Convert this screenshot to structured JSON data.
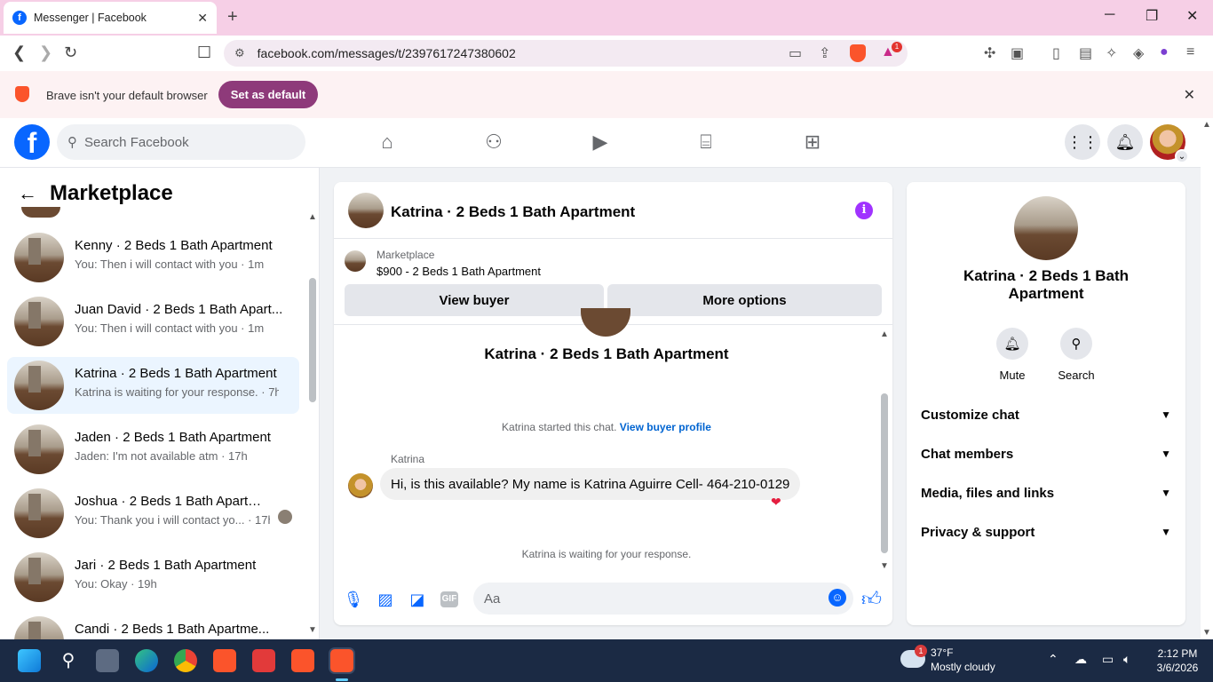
{
  "browser": {
    "tab_title": "Messenger | Facebook",
    "url": "facebook.com/messages/t/2397617247380602",
    "notification_count": "1",
    "banner_message": "Brave isn't your default browser",
    "banner_button": "Set as default"
  },
  "fb_header": {
    "search_placeholder": "Search Facebook"
  },
  "sidebar": {
    "title": "Marketplace",
    "conversations": [
      {
        "name": "Kenny · 2 Beds 1 Bath Apartment",
        "preview": "You: Then i will contact with you · 1m"
      },
      {
        "name": "Juan David · 2 Beds 1 Bath Apart...",
        "preview": "You: Then i will contact with you · 1m"
      },
      {
        "name": "Katrina · 2 Beds 1 Bath Apartment",
        "preview": "Katrina is waiting for your response. · 7h"
      },
      {
        "name": "Jaden · 2 Beds 1 Bath Apartment",
        "preview": "Jaden: I'm not available atm · 17h"
      },
      {
        "name": "Joshua · 2 Beds 1 Bath Apartm...",
        "preview": "You: Thank you i will contact yo... · 17h"
      },
      {
        "name": "Jari · 2 Beds 1 Bath Apartment",
        "preview": "You: Okay · 19h"
      },
      {
        "name": "Candi · 2 Beds 1 Bath Apartme...",
        "preview": ""
      }
    ]
  },
  "chat": {
    "title": "Katrina · 2 Beds 1 Bath Apartment",
    "listing_label": "Marketplace",
    "listing_price": "$900 - 2 Beds 1 Bath Apartment",
    "view_buyer": "View buyer",
    "more_options": "More options",
    "intro_title": "Katrina · 2 Beds 1 Bath Apartment",
    "started_text": "Katrina started this chat.",
    "view_profile": "View buyer profile",
    "sender": "Katrina",
    "message": "Hi, is this available? My name is Katrina Aguirre Cell- 464-210-0129",
    "waiting": "Katrina is waiting for your response.",
    "input_placeholder": "Aa"
  },
  "info_panel": {
    "name": "Katrina · 2 Beds 1 Bath Apartment",
    "mute": "Mute",
    "search": "Search",
    "sections": [
      "Customize chat",
      "Chat members",
      "Media, files and links",
      "Privacy & support"
    ]
  },
  "taskbar": {
    "weather_badge": "1",
    "temperature": "37°F",
    "condition": "Mostly cloudy",
    "time": "2:12 PM",
    "date": "3/6/2026"
  }
}
